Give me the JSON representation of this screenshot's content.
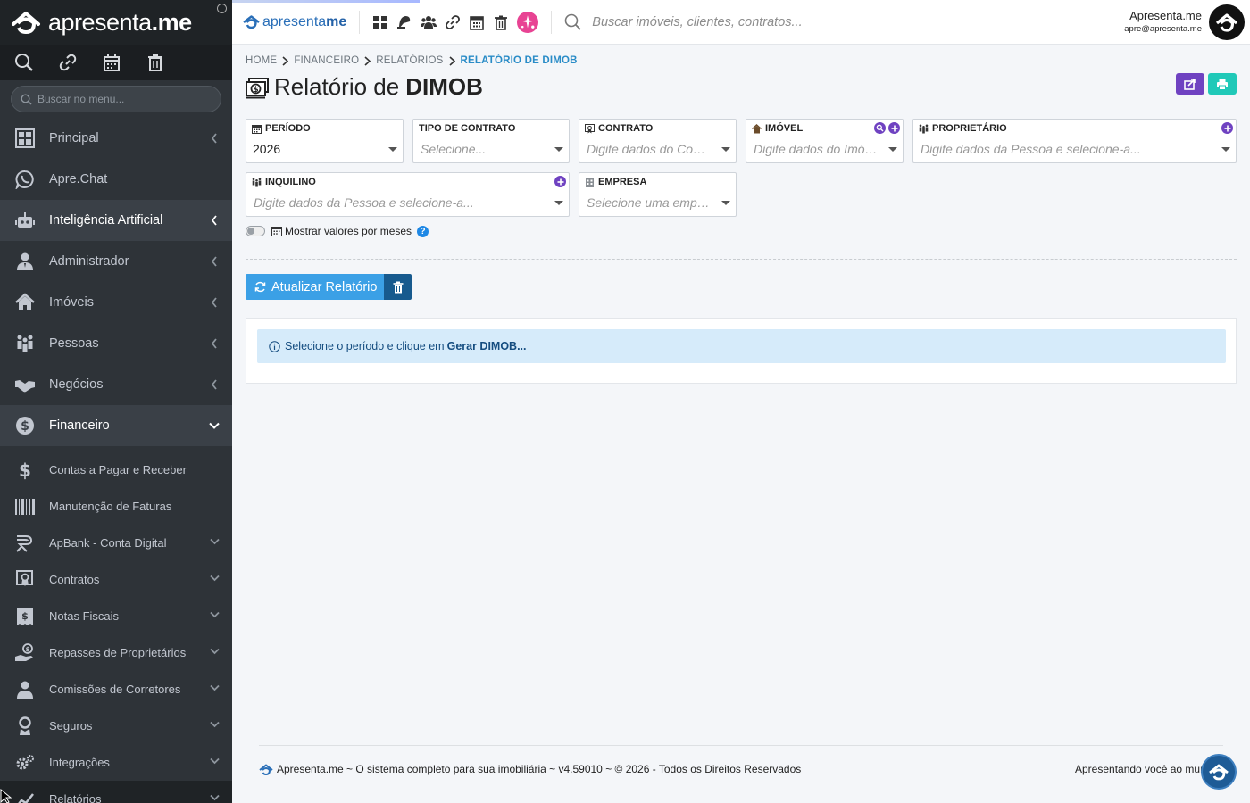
{
  "sidebar": {
    "brand_a": "apresenta",
    "brand_b": ".me",
    "search_placeholder": "Buscar no menu...",
    "items": [
      {
        "label": "Principal"
      },
      {
        "label": "Apre.Chat"
      },
      {
        "label": "Inteligência Artificial"
      },
      {
        "label": "Administrador"
      },
      {
        "label": "Imóveis"
      },
      {
        "label": "Pessoas"
      },
      {
        "label": "Negócios"
      },
      {
        "label": "Financeiro"
      }
    ],
    "sub_items": [
      {
        "label": "Contas a Pagar e Receber"
      },
      {
        "label": "Manutenção de Faturas"
      },
      {
        "label": "ApBank - Conta Digital"
      },
      {
        "label": "Contratos"
      },
      {
        "label": "Notas Fiscais"
      },
      {
        "label": "Repasses de Proprietários"
      },
      {
        "label": "Comissões de Corretores"
      },
      {
        "label": "Seguros"
      },
      {
        "label": "Integrações"
      },
      {
        "label": "Relatórios"
      }
    ]
  },
  "topbar": {
    "brand_a": "apresenta",
    "brand_b": "me",
    "search_placeholder": "Buscar imóveis, clientes, contratos...",
    "user_name": "Apresenta.me",
    "user_email": "apre@apresenta.me"
  },
  "breadcrumb": [
    "HOME",
    "FINANCEIRO",
    "RELATÓRIOS",
    "RELATÓRIO DE DIMOB"
  ],
  "page": {
    "title_a": "Relatório de",
    "title_b": "DIMOB"
  },
  "filters": {
    "periodo": {
      "label": "PERÍODO",
      "value": "2026"
    },
    "tipo_contrato": {
      "label": "TIPO DE CONTRATO",
      "placeholder": "Selecione..."
    },
    "contrato": {
      "label": "CONTRATO",
      "placeholder": "Digite dados do Contrato"
    },
    "imovel": {
      "label": "IMÓVEL",
      "placeholder": "Digite dados do Imóvel"
    },
    "proprietario": {
      "label": "PROPRIETÁRIO",
      "placeholder": "Digite dados da Pessoa e selecione-a..."
    },
    "inquilino": {
      "label": "INQUILINO",
      "placeholder": "Digite dados da Pessoa e selecione-a..."
    },
    "empresa": {
      "label": "EMPRESA",
      "placeholder": "Selecione uma empresa"
    }
  },
  "toggle_label": "Mostrar valores por meses",
  "help_glyph": "?",
  "update_button": "Atualizar Relatório",
  "alert": {
    "text": "Selecione o período e clique em",
    "strong": "Gerar DIMOB..."
  },
  "footer": {
    "left": "Apresenta.me ~ O sistema completo para sua imobiliária ~ v4.59010 ~ © 2026 - Todos os Direitos Reservados",
    "right": "Apresentando você ao mundo"
  },
  "colors": {
    "sidebar_bg": "#2e3338",
    "accent_blue": "#3ba0e6",
    "purple": "#6f42c1",
    "teal": "#20c9b8",
    "pink": "#e84393"
  }
}
